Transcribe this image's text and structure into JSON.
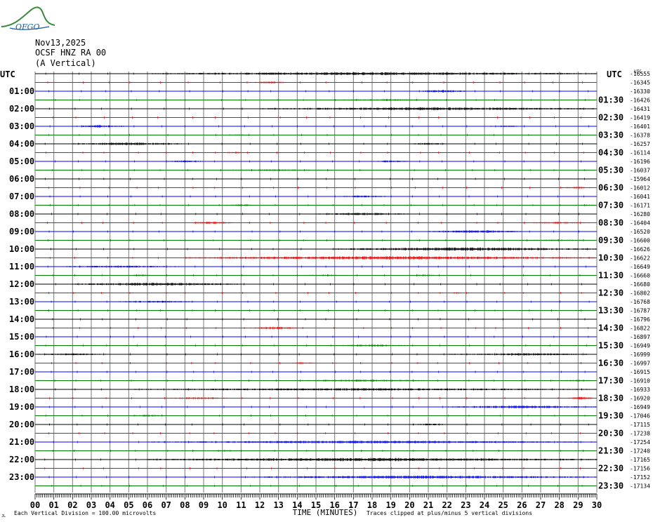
{
  "logo": {
    "text": "OFGO",
    "icon": "ofgo-mountain-logo"
  },
  "header": {
    "date": "Nov13,2025",
    "station": "OCSF HNZ RA 00",
    "component": "(A Vertical)"
  },
  "left_axis_title": "UTC",
  "right_axis_title": "UTC",
  "right_axis_units": "UTC",
  "chart_data": {
    "type": "helicorder",
    "x_axis": {
      "label": "TIME (MINUTES)",
      "min": 0,
      "max": 30,
      "ticks": [
        "00",
        "01",
        "02",
        "03",
        "04",
        "05",
        "06",
        "07",
        "08",
        "09",
        "10",
        "11",
        "12",
        "13",
        "14",
        "15",
        "16",
        "17",
        "18",
        "19",
        "20",
        "21",
        "22",
        "23",
        "24",
        "25",
        "26",
        "27",
        "28",
        "29",
        "30"
      ]
    },
    "left_hour_labels": [
      "01:00",
      "02:00",
      "03:00",
      "04:00",
      "05:00",
      "06:00",
      "07:00",
      "08:00",
      "09:00",
      "10:00",
      "11:00",
      "12:00",
      "13:00",
      "14:00",
      "15:00",
      "16:00",
      "17:00",
      "18:00",
      "19:00",
      "20:00",
      "21:00",
      "22:00",
      "23:00"
    ],
    "right_hour_labels": [
      "01:30",
      "02:30",
      "03:30",
      "04:30",
      "05:30",
      "06:30",
      "07:30",
      "08:30",
      "09:30",
      "10:30",
      "11:30",
      "12:30",
      "13:30",
      "14:30",
      "15:30",
      "16:30",
      "17:30",
      "18:30",
      "19:30",
      "20:30",
      "21:30",
      "22:30",
      "23:30"
    ],
    "trace_colors": [
      "#000000",
      "#ff0000",
      "#0000ff",
      "#008000"
    ],
    "trace_offsets": [
      -16555,
      -16345,
      -16330,
      -16426,
      -16431,
      -16419,
      -16401,
      -16378,
      -16257,
      -16114,
      -16196,
      -16037,
      -15964,
      -16012,
      -16041,
      -16171,
      -16280,
      -16404,
      -16520,
      -16600,
      -16626,
      -16622,
      -16649,
      -16660,
      -16680,
      -16802,
      -16768,
      -16787,
      -16796,
      -16822,
      -16897,
      -16949,
      -16999,
      -16997,
      -16915,
      -16910,
      -16933,
      -16920,
      -16949,
      -17046,
      -17115,
      -17238,
      -17254,
      -17240,
      -17165,
      -17156,
      -17152,
      -17134
    ],
    "activity": [
      [
        [
          6,
          30,
          0.9
        ]
      ],
      [
        [
          11.5,
          13.5,
          0.6
        ]
      ],
      [
        [
          20.5,
          23,
          0.8
        ]
      ],
      [
        [
          15,
          23,
          0.5
        ]
      ],
      [
        [
          12,
          30,
          0.9
        ]
      ],
      [],
      [
        [
          2,
          5,
          0.7
        ],
        [
          24,
          26,
          0.5
        ]
      ],
      [
        [
          10,
          11.5,
          0.5
        ]
      ],
      [
        [
          2,
          8,
          0.8
        ],
        [
          20,
          22,
          0.6
        ]
      ],
      [
        [
          10,
          11.5,
          0.5
        ]
      ],
      [
        [
          7,
          9,
          0.6
        ],
        [
          18,
          20,
          0.6
        ]
      ],
      [
        [
          9.5,
          16,
          0.5
        ]
      ],
      [],
      [
        [
          28,
          30,
          0.5
        ]
      ],
      [
        [
          16,
          19,
          0.6
        ]
      ],
      [
        [
          10,
          12,
          0.5
        ],
        [
          29,
          30,
          0.5
        ]
      ],
      [
        [
          15,
          20,
          0.8
        ]
      ],
      [
        [
          8,
          11,
          0.6
        ],
        [
          26,
          30,
          0.5
        ]
      ],
      [
        [
          21,
          26,
          0.8
        ]
      ],
      [
        [
          26,
          30,
          0.5
        ]
      ],
      [
        [
          16,
          30,
          1.0
        ]
      ],
      [
        [
          8,
          30,
          1.0
        ]
      ],
      [
        [
          1,
          8,
          0.6
        ]
      ],
      [
        [
          5,
          6.5,
          0.5
        ],
        [
          14,
          17,
          0.5
        ],
        [
          20,
          21.5,
          0.5
        ]
      ],
      [
        [
          2,
          11,
          0.9
        ]
      ],
      [
        [
          22,
          23,
          0.5
        ]
      ],
      [
        [
          4,
          9,
          0.6
        ]
      ],
      [],
      [],
      [
        [
          11.5,
          14,
          0.8
        ]
      ],
      [],
      [
        [
          16,
          20,
          0.6
        ]
      ],
      [
        [
          0,
          4,
          0.6
        ],
        [
          22,
          30,
          0.7
        ]
      ],
      [
        [
          13.5,
          15,
          0.5
        ]
      ],
      [],
      [
        [
          13,
          22,
          0.6
        ],
        [
          28,
          30,
          0.5
        ]
      ],
      [
        [
          5,
          30,
          0.7
        ]
      ],
      [
        [
          7,
          10.5,
          0.6
        ],
        [
          28.5,
          30,
          0.8
        ]
      ],
      [
        [
          22,
          30,
          0.8
        ]
      ],
      [
        [
          5,
          7,
          0.6
        ]
      ],
      [
        [
          20,
          22,
          0.6
        ]
      ],
      [],
      [
        [
          6,
          30,
          0.8
        ]
      ],
      [
        [
          9.5,
          11,
          0.5
        ]
      ],
      [
        [
          6,
          30,
          1.0
        ]
      ],
      [],
      [
        [
          11,
          30,
          0.9
        ]
      ],
      []
    ]
  },
  "footer": {
    "scale_note": "Each Vertical Division =  100.00 microvolts",
    "clip_note": "Traces clipped at plus/minus 5 vertical divisions",
    "corner_mark": "JL"
  }
}
